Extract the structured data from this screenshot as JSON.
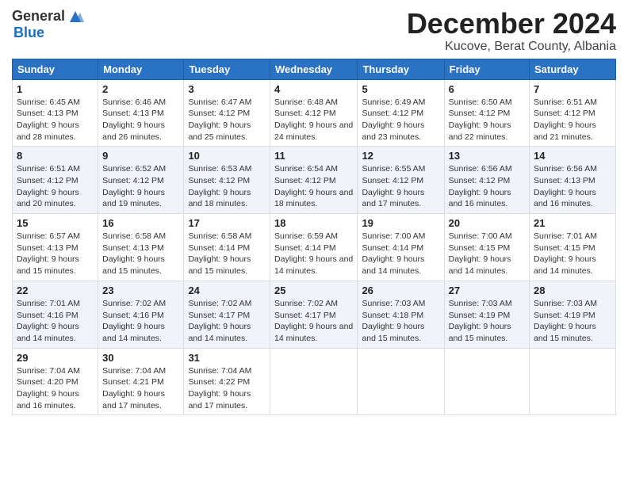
{
  "logo": {
    "general": "General",
    "blue": "Blue"
  },
  "title": "December 2024",
  "subtitle": "Kucove, Berat County, Albania",
  "days_of_week": [
    "Sunday",
    "Monday",
    "Tuesday",
    "Wednesday",
    "Thursday",
    "Friday",
    "Saturday"
  ],
  "weeks": [
    [
      {
        "day": "1",
        "sunrise": "6:45 AM",
        "sunset": "4:13 PM",
        "daylight": "9 hours and 28 minutes."
      },
      {
        "day": "2",
        "sunrise": "6:46 AM",
        "sunset": "4:13 PM",
        "daylight": "9 hours and 26 minutes."
      },
      {
        "day": "3",
        "sunrise": "6:47 AM",
        "sunset": "4:12 PM",
        "daylight": "9 hours and 25 minutes."
      },
      {
        "day": "4",
        "sunrise": "6:48 AM",
        "sunset": "4:12 PM",
        "daylight": "9 hours and 24 minutes."
      },
      {
        "day": "5",
        "sunrise": "6:49 AM",
        "sunset": "4:12 PM",
        "daylight": "9 hours and 23 minutes."
      },
      {
        "day": "6",
        "sunrise": "6:50 AM",
        "sunset": "4:12 PM",
        "daylight": "9 hours and 22 minutes."
      },
      {
        "day": "7",
        "sunrise": "6:51 AM",
        "sunset": "4:12 PM",
        "daylight": "9 hours and 21 minutes."
      }
    ],
    [
      {
        "day": "8",
        "sunrise": "6:51 AM",
        "sunset": "4:12 PM",
        "daylight": "9 hours and 20 minutes."
      },
      {
        "day": "9",
        "sunrise": "6:52 AM",
        "sunset": "4:12 PM",
        "daylight": "9 hours and 19 minutes."
      },
      {
        "day": "10",
        "sunrise": "6:53 AM",
        "sunset": "4:12 PM",
        "daylight": "9 hours and 18 minutes."
      },
      {
        "day": "11",
        "sunrise": "6:54 AM",
        "sunset": "4:12 PM",
        "daylight": "9 hours and 18 minutes."
      },
      {
        "day": "12",
        "sunrise": "6:55 AM",
        "sunset": "4:12 PM",
        "daylight": "9 hours and 17 minutes."
      },
      {
        "day": "13",
        "sunrise": "6:56 AM",
        "sunset": "4:12 PM",
        "daylight": "9 hours and 16 minutes."
      },
      {
        "day": "14",
        "sunrise": "6:56 AM",
        "sunset": "4:13 PM",
        "daylight": "9 hours and 16 minutes."
      }
    ],
    [
      {
        "day": "15",
        "sunrise": "6:57 AM",
        "sunset": "4:13 PM",
        "daylight": "9 hours and 15 minutes."
      },
      {
        "day": "16",
        "sunrise": "6:58 AM",
        "sunset": "4:13 PM",
        "daylight": "9 hours and 15 minutes."
      },
      {
        "day": "17",
        "sunrise": "6:58 AM",
        "sunset": "4:14 PM",
        "daylight": "9 hours and 15 minutes."
      },
      {
        "day": "18",
        "sunrise": "6:59 AM",
        "sunset": "4:14 PM",
        "daylight": "9 hours and 14 minutes."
      },
      {
        "day": "19",
        "sunrise": "7:00 AM",
        "sunset": "4:14 PM",
        "daylight": "9 hours and 14 minutes."
      },
      {
        "day": "20",
        "sunrise": "7:00 AM",
        "sunset": "4:15 PM",
        "daylight": "9 hours and 14 minutes."
      },
      {
        "day": "21",
        "sunrise": "7:01 AM",
        "sunset": "4:15 PM",
        "daylight": "9 hours and 14 minutes."
      }
    ],
    [
      {
        "day": "22",
        "sunrise": "7:01 AM",
        "sunset": "4:16 PM",
        "daylight": "9 hours and 14 minutes."
      },
      {
        "day": "23",
        "sunrise": "7:02 AM",
        "sunset": "4:16 PM",
        "daylight": "9 hours and 14 minutes."
      },
      {
        "day": "24",
        "sunrise": "7:02 AM",
        "sunset": "4:17 PM",
        "daylight": "9 hours and 14 minutes."
      },
      {
        "day": "25",
        "sunrise": "7:02 AM",
        "sunset": "4:17 PM",
        "daylight": "9 hours and 14 minutes."
      },
      {
        "day": "26",
        "sunrise": "7:03 AM",
        "sunset": "4:18 PM",
        "daylight": "9 hours and 15 minutes."
      },
      {
        "day": "27",
        "sunrise": "7:03 AM",
        "sunset": "4:19 PM",
        "daylight": "9 hours and 15 minutes."
      },
      {
        "day": "28",
        "sunrise": "7:03 AM",
        "sunset": "4:19 PM",
        "daylight": "9 hours and 15 minutes."
      }
    ],
    [
      {
        "day": "29",
        "sunrise": "7:04 AM",
        "sunset": "4:20 PM",
        "daylight": "9 hours and 16 minutes."
      },
      {
        "day": "30",
        "sunrise": "7:04 AM",
        "sunset": "4:21 PM",
        "daylight": "9 hours and 17 minutes."
      },
      {
        "day": "31",
        "sunrise": "7:04 AM",
        "sunset": "4:22 PM",
        "daylight": "9 hours and 17 minutes."
      },
      null,
      null,
      null,
      null
    ]
  ]
}
